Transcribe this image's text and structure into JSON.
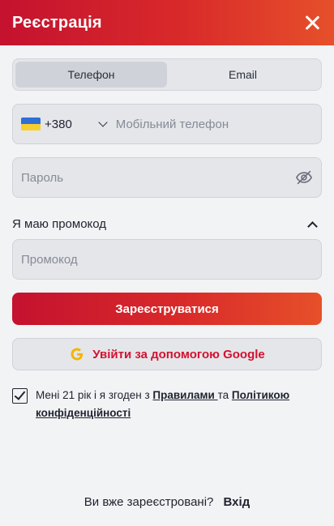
{
  "header": {
    "title": "Реєстрація",
    "close_icon": "close-icon"
  },
  "tabs": [
    {
      "label": "Телефон",
      "active": true
    },
    {
      "label": "Email",
      "active": false
    }
  ],
  "phone": {
    "country_flag": "ukraine-flag-icon",
    "country_code": "+380",
    "placeholder": "Мобільний телефон",
    "value": ""
  },
  "password": {
    "placeholder": "Пароль",
    "value": "",
    "toggle_icon": "eye-off-icon"
  },
  "promo": {
    "toggle_label": "Я маю промокод",
    "placeholder": "Промокод",
    "value": "",
    "expanded": true
  },
  "buttons": {
    "register": "Зареєструватися",
    "google": "Увійти за допомогою Google"
  },
  "agreement": {
    "checked": true,
    "prefix": "Мені 21 рік і я згоден з ",
    "rules_link": "Правилами ",
    "middle": "та ",
    "privacy_link": "Політикою конфіденційності"
  },
  "footer": {
    "question": "Ви вже зареєстровані?",
    "login_link": "Вхід"
  },
  "colors": {
    "accent_start": "#c4122f",
    "accent_end": "#e6502a",
    "google_text": "#d3122f"
  }
}
